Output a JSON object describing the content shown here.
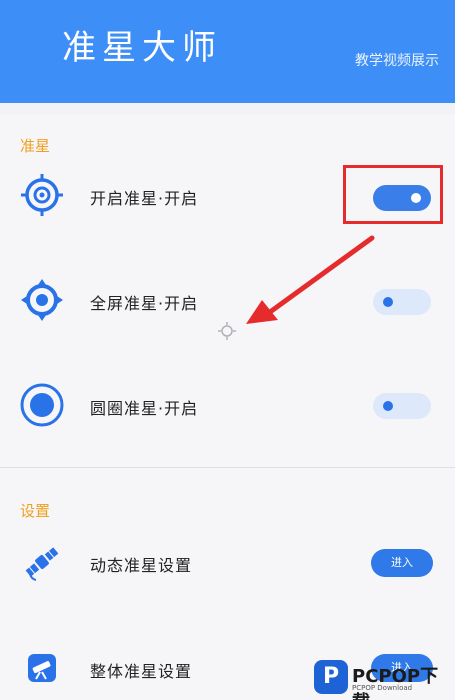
{
  "header": {
    "title": "准星大师",
    "video_link": "教学视频展示",
    "bg_color": "#3d8ef7"
  },
  "crosshair_section": {
    "title": "准星",
    "items": [
      {
        "label": "开启准星·开启",
        "icon": "crosshair-ring-icon",
        "toggle_on": true
      },
      {
        "label": "全屏准星·开启",
        "icon": "crosshair-diamond-icon",
        "toggle_on": false
      },
      {
        "label": "圆圈准星·开启",
        "icon": "crosshair-dot-icon",
        "toggle_on": false
      }
    ]
  },
  "settings_section": {
    "title": "设置",
    "items": [
      {
        "label": "动态准星设置",
        "icon": "satellite-icon",
        "button": "进入"
      },
      {
        "label": "整体准星设置",
        "icon": "telescope-icon",
        "button": "进入"
      }
    ]
  },
  "watermark": {
    "logo": "P",
    "text": "PCPOP下载",
    "sub": "PCPOP Download"
  },
  "colors": {
    "accent": "#3a7fe9",
    "section_title": "#f0a020",
    "annotation": "#e52b2b"
  }
}
